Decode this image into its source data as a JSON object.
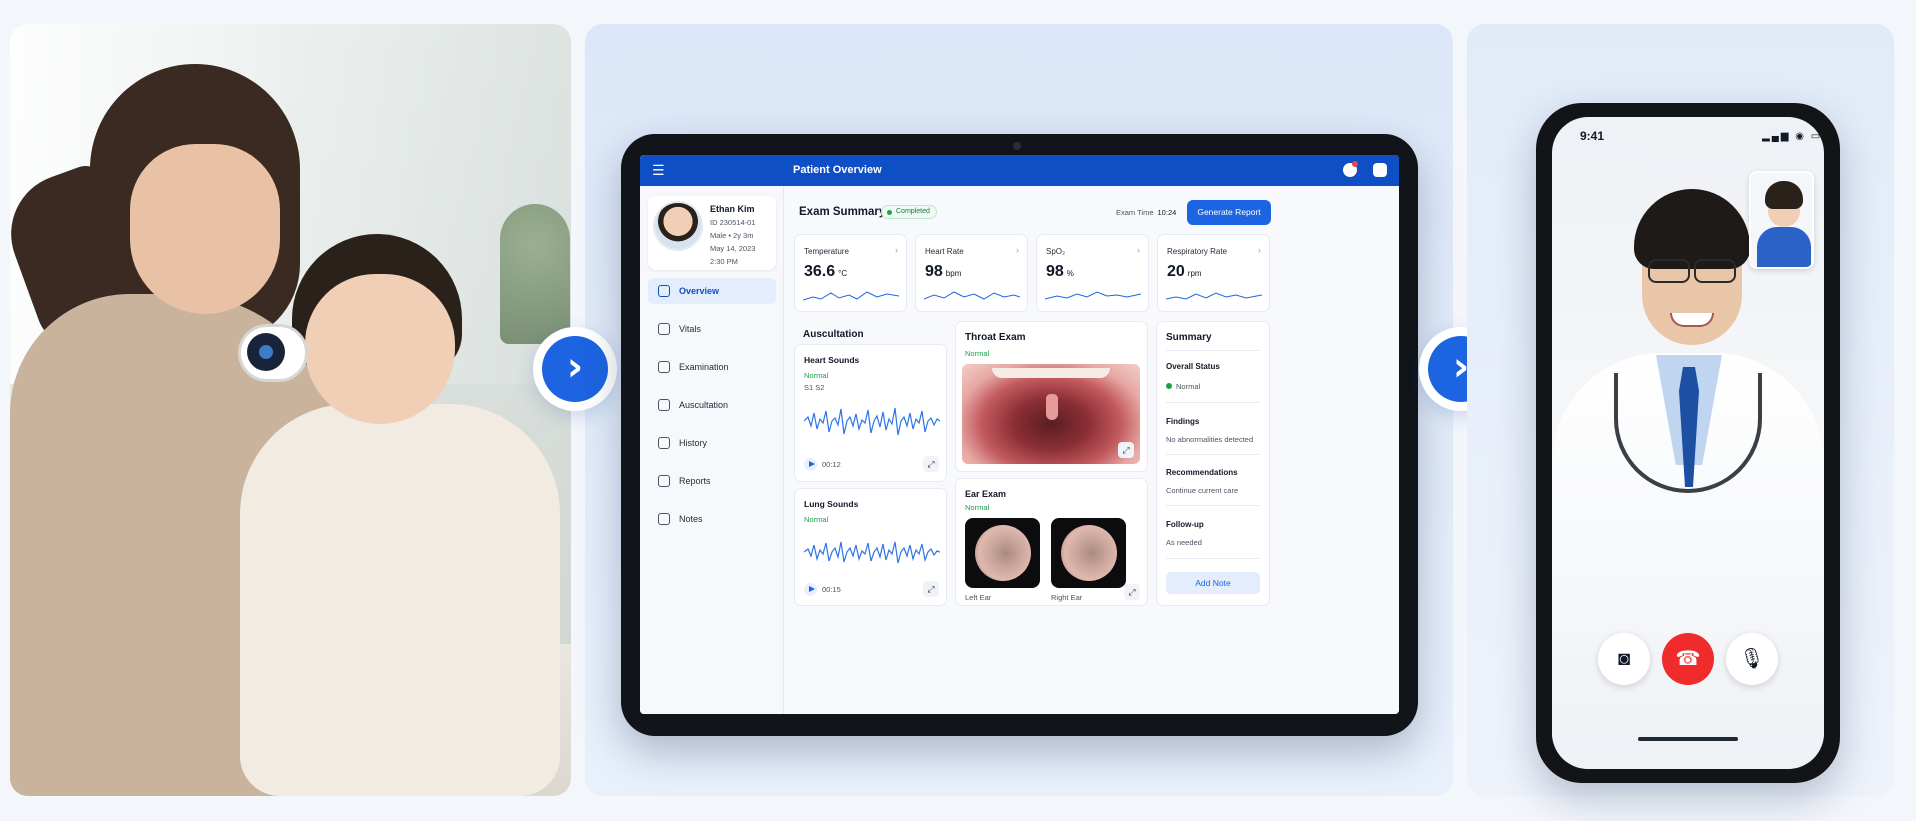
{
  "tablet": {
    "app_title": "Patient Overview",
    "menu_icon": "hamburger-icon",
    "patient": {
      "name": "Ethan Kim",
      "id": "ID 230514-01",
      "demographics": "Male • 2y 3m",
      "date": "May 14, 2023",
      "time": "2:30 PM"
    },
    "nav": [
      {
        "label": "Overview",
        "icon": "home-icon",
        "active": true
      },
      {
        "label": "Vitals",
        "icon": "stethoscope-icon"
      },
      {
        "label": "Examination",
        "icon": "exam-icon"
      },
      {
        "label": "Auscultation",
        "icon": "ear-icon"
      },
      {
        "label": "History",
        "icon": "history-icon"
      },
      {
        "label": "Reports",
        "icon": "report-icon"
      },
      {
        "label": "Notes",
        "icon": "notes-icon"
      }
    ],
    "header": {
      "title": "Exam Summary",
      "status": "Completed",
      "exam_time_label": "Exam Time",
      "exam_time": "10:24",
      "generate_label": "Generate Report"
    },
    "vitals": [
      {
        "title": "Temperature",
        "value": "36.6",
        "unit": "°C"
      },
      {
        "title": "Heart Rate",
        "value": "98",
        "unit": "bpm"
      },
      {
        "title": "SpO₂",
        "value": "98",
        "unit": "%"
      },
      {
        "title": "Respiratory Rate",
        "value": "20",
        "unit": "rpm"
      }
    ],
    "auscultation": {
      "title": "Auscultation",
      "heart": {
        "title": "Heart Sounds",
        "status": "Normal",
        "detail": "S1 S2",
        "duration": "00:12"
      },
      "lung": {
        "title": "Lung Sounds",
        "status": "Normal",
        "duration": "00:15"
      }
    },
    "throat": {
      "title": "Throat Exam",
      "status": "Normal"
    },
    "ear": {
      "title": "Ear Exam",
      "status": "Normal",
      "left": "Left Ear",
      "right": "Right Ear"
    },
    "summary": {
      "title": "Summary",
      "overall_label": "Overall Status",
      "overall_value": "Normal",
      "findings_label": "Findings",
      "findings_value": "No abnormalities detected",
      "recommendations_label": "Recommendations",
      "recommendations_value": "Continue current care",
      "followup_label": "Follow-up",
      "followup_value": "As needed",
      "add_note_label": "Add Note"
    },
    "colors": {
      "primary": "#1d64e2",
      "app_bar": "#0f4fc6",
      "normal": "#16a34a"
    }
  },
  "phone": {
    "time": "9:41",
    "status_icons": "▂▄▆ ◉ ▭",
    "call_controls": [
      {
        "icon": "camera-icon",
        "glyph": "◙"
      },
      {
        "icon": "end-call-icon",
        "glyph": "☎"
      },
      {
        "icon": "microphone-icon",
        "glyph": "🎙"
      }
    ],
    "end_call_color": "#ef2b2b"
  },
  "arrows": {
    "glyph": "›"
  }
}
